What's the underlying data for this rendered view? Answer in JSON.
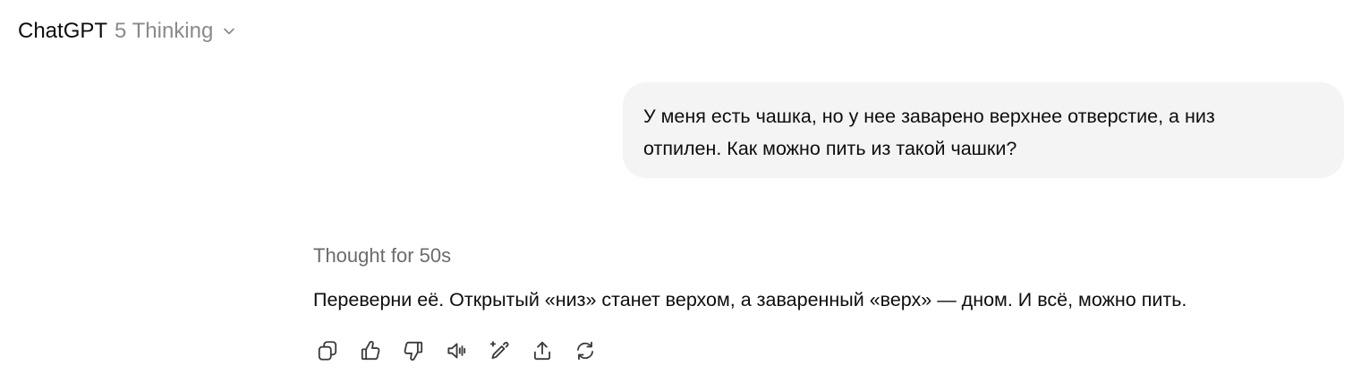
{
  "header": {
    "model_name": "ChatGPT",
    "model_variant": "5 Thinking",
    "dropdown_icon": "chevron-down-icon"
  },
  "conversation": {
    "user_message": {
      "line1": "У меня есть чашка, но у нее заварено верхнее отверстие, а низ",
      "line2": "отпилен. Как можно пить из такой чашки?"
    },
    "assistant": {
      "thought_label": "Thought for 50s",
      "answer": "Переверни её. Открытый «низ» станет верхом, а заваренный «верх» — дном. И всё, можно пить."
    }
  },
  "actions": [
    {
      "name": "copy",
      "icon": "copy-icon"
    },
    {
      "name": "good-response",
      "icon": "thumbs-up-icon"
    },
    {
      "name": "bad-response",
      "icon": "thumbs-down-icon"
    },
    {
      "name": "read-aloud",
      "icon": "speaker-icon"
    },
    {
      "name": "edit-in-canvas",
      "icon": "pencil-sparkle-icon"
    },
    {
      "name": "share",
      "icon": "share-icon"
    },
    {
      "name": "regenerate",
      "icon": "refresh-icon"
    }
  ]
}
